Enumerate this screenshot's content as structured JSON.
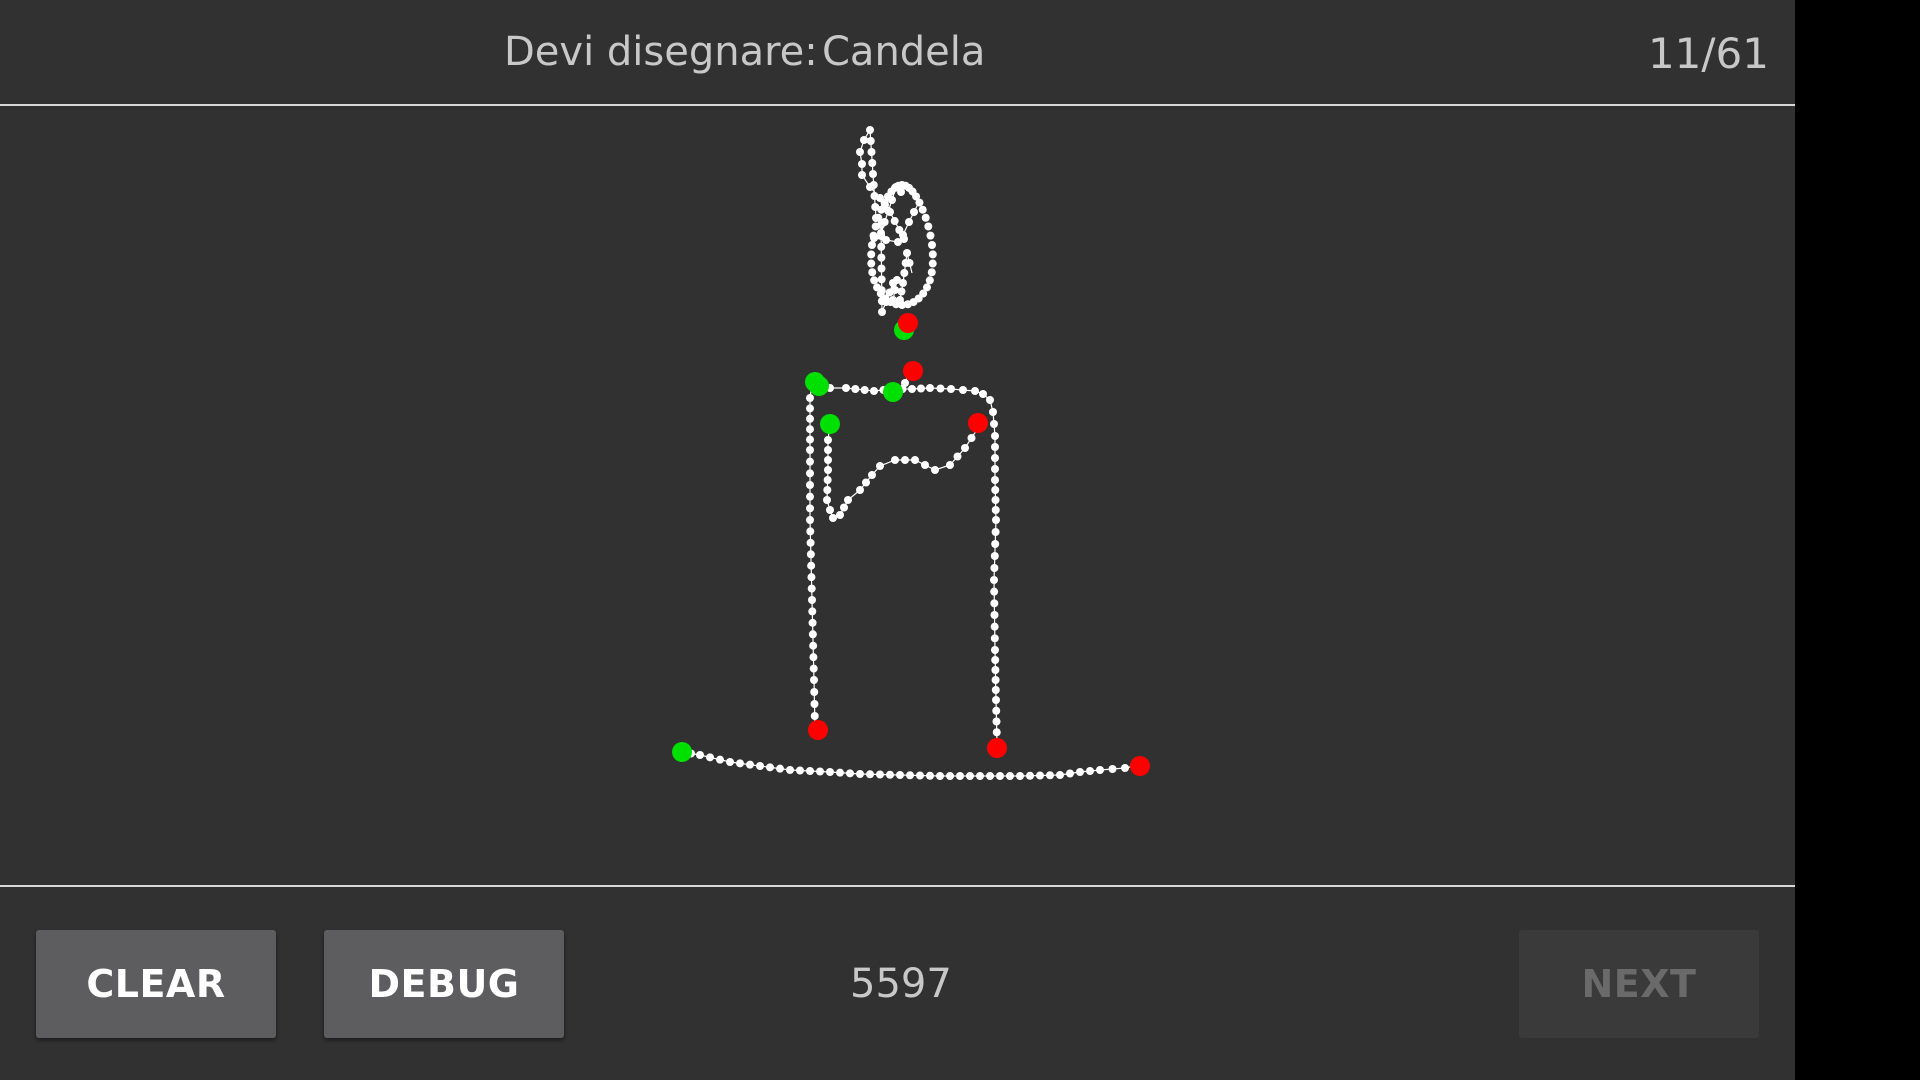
{
  "header": {
    "prompt_label": "Devi disegnare:",
    "prompt_word": "Candela",
    "progress": "11/61"
  },
  "toolbar": {
    "clear_label": "CLEAR",
    "debug_label": "DEBUG",
    "score": "5597",
    "next_label": "NEXT"
  },
  "colors": {
    "background": "#313131",
    "stroke_dots": "#ffffff",
    "stroke_start": "#00e000",
    "stroke_end": "#ff0000"
  }
}
